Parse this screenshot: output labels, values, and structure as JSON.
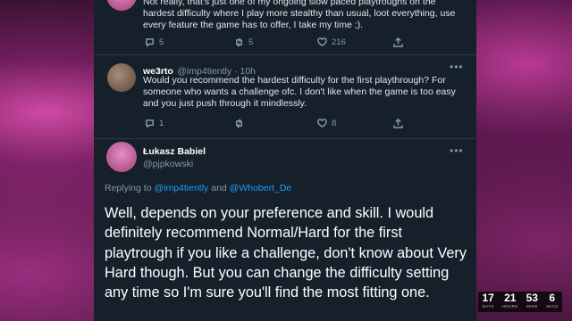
{
  "tweet_prev": {
    "text_line1": "Not really, that's just one of my ongoing slow paced playtrougns on the",
    "text_line2": "hardest difficulty where I play more stealthy than usual, loot everything, use",
    "text_line3": "every feature the game has to offer, I take my time ;).",
    "replies": "5",
    "retweets": "5",
    "likes": "216"
  },
  "tweet_we3rto": {
    "name": "we3rto",
    "handle_time": "@imp4tiently · 10h",
    "text_line1": "Would you recommend the hardest difficulty for the first playthrough? For",
    "text_line2": "someone who wants a challenge ofc. I don't like when the game is too easy",
    "text_line3": "and you just push through it mindlessly.",
    "replies": "1",
    "retweets": "",
    "likes": "8"
  },
  "tweet_main": {
    "name": "Łukasz Babiel",
    "handle": "@pjpkowski",
    "replying_prefix": "Replying to ",
    "replying_user1": "@imp4tiently",
    "replying_and": " and ",
    "replying_user2": "@Whobert_De",
    "text": "Well, depends on your preference and skill. I would definitely recommend Normal/Hard for the first playtrough if you like a challenge, don't know about Very Hard though. But you can change the difficulty setting any time so I'm sure you'll find the most fitting one."
  },
  "more_glyph": "•••",
  "countdown": {
    "days": "17",
    "days_label": "DAYS",
    "hours": "21",
    "hours_label": "HOURS",
    "mins": "53",
    "mins_label": "MINS",
    "secs": "6",
    "secs_label": "SECS"
  },
  "colors": {
    "panel_bg": "#15202b",
    "link": "#1da1f2",
    "muted": "#8899a6"
  }
}
